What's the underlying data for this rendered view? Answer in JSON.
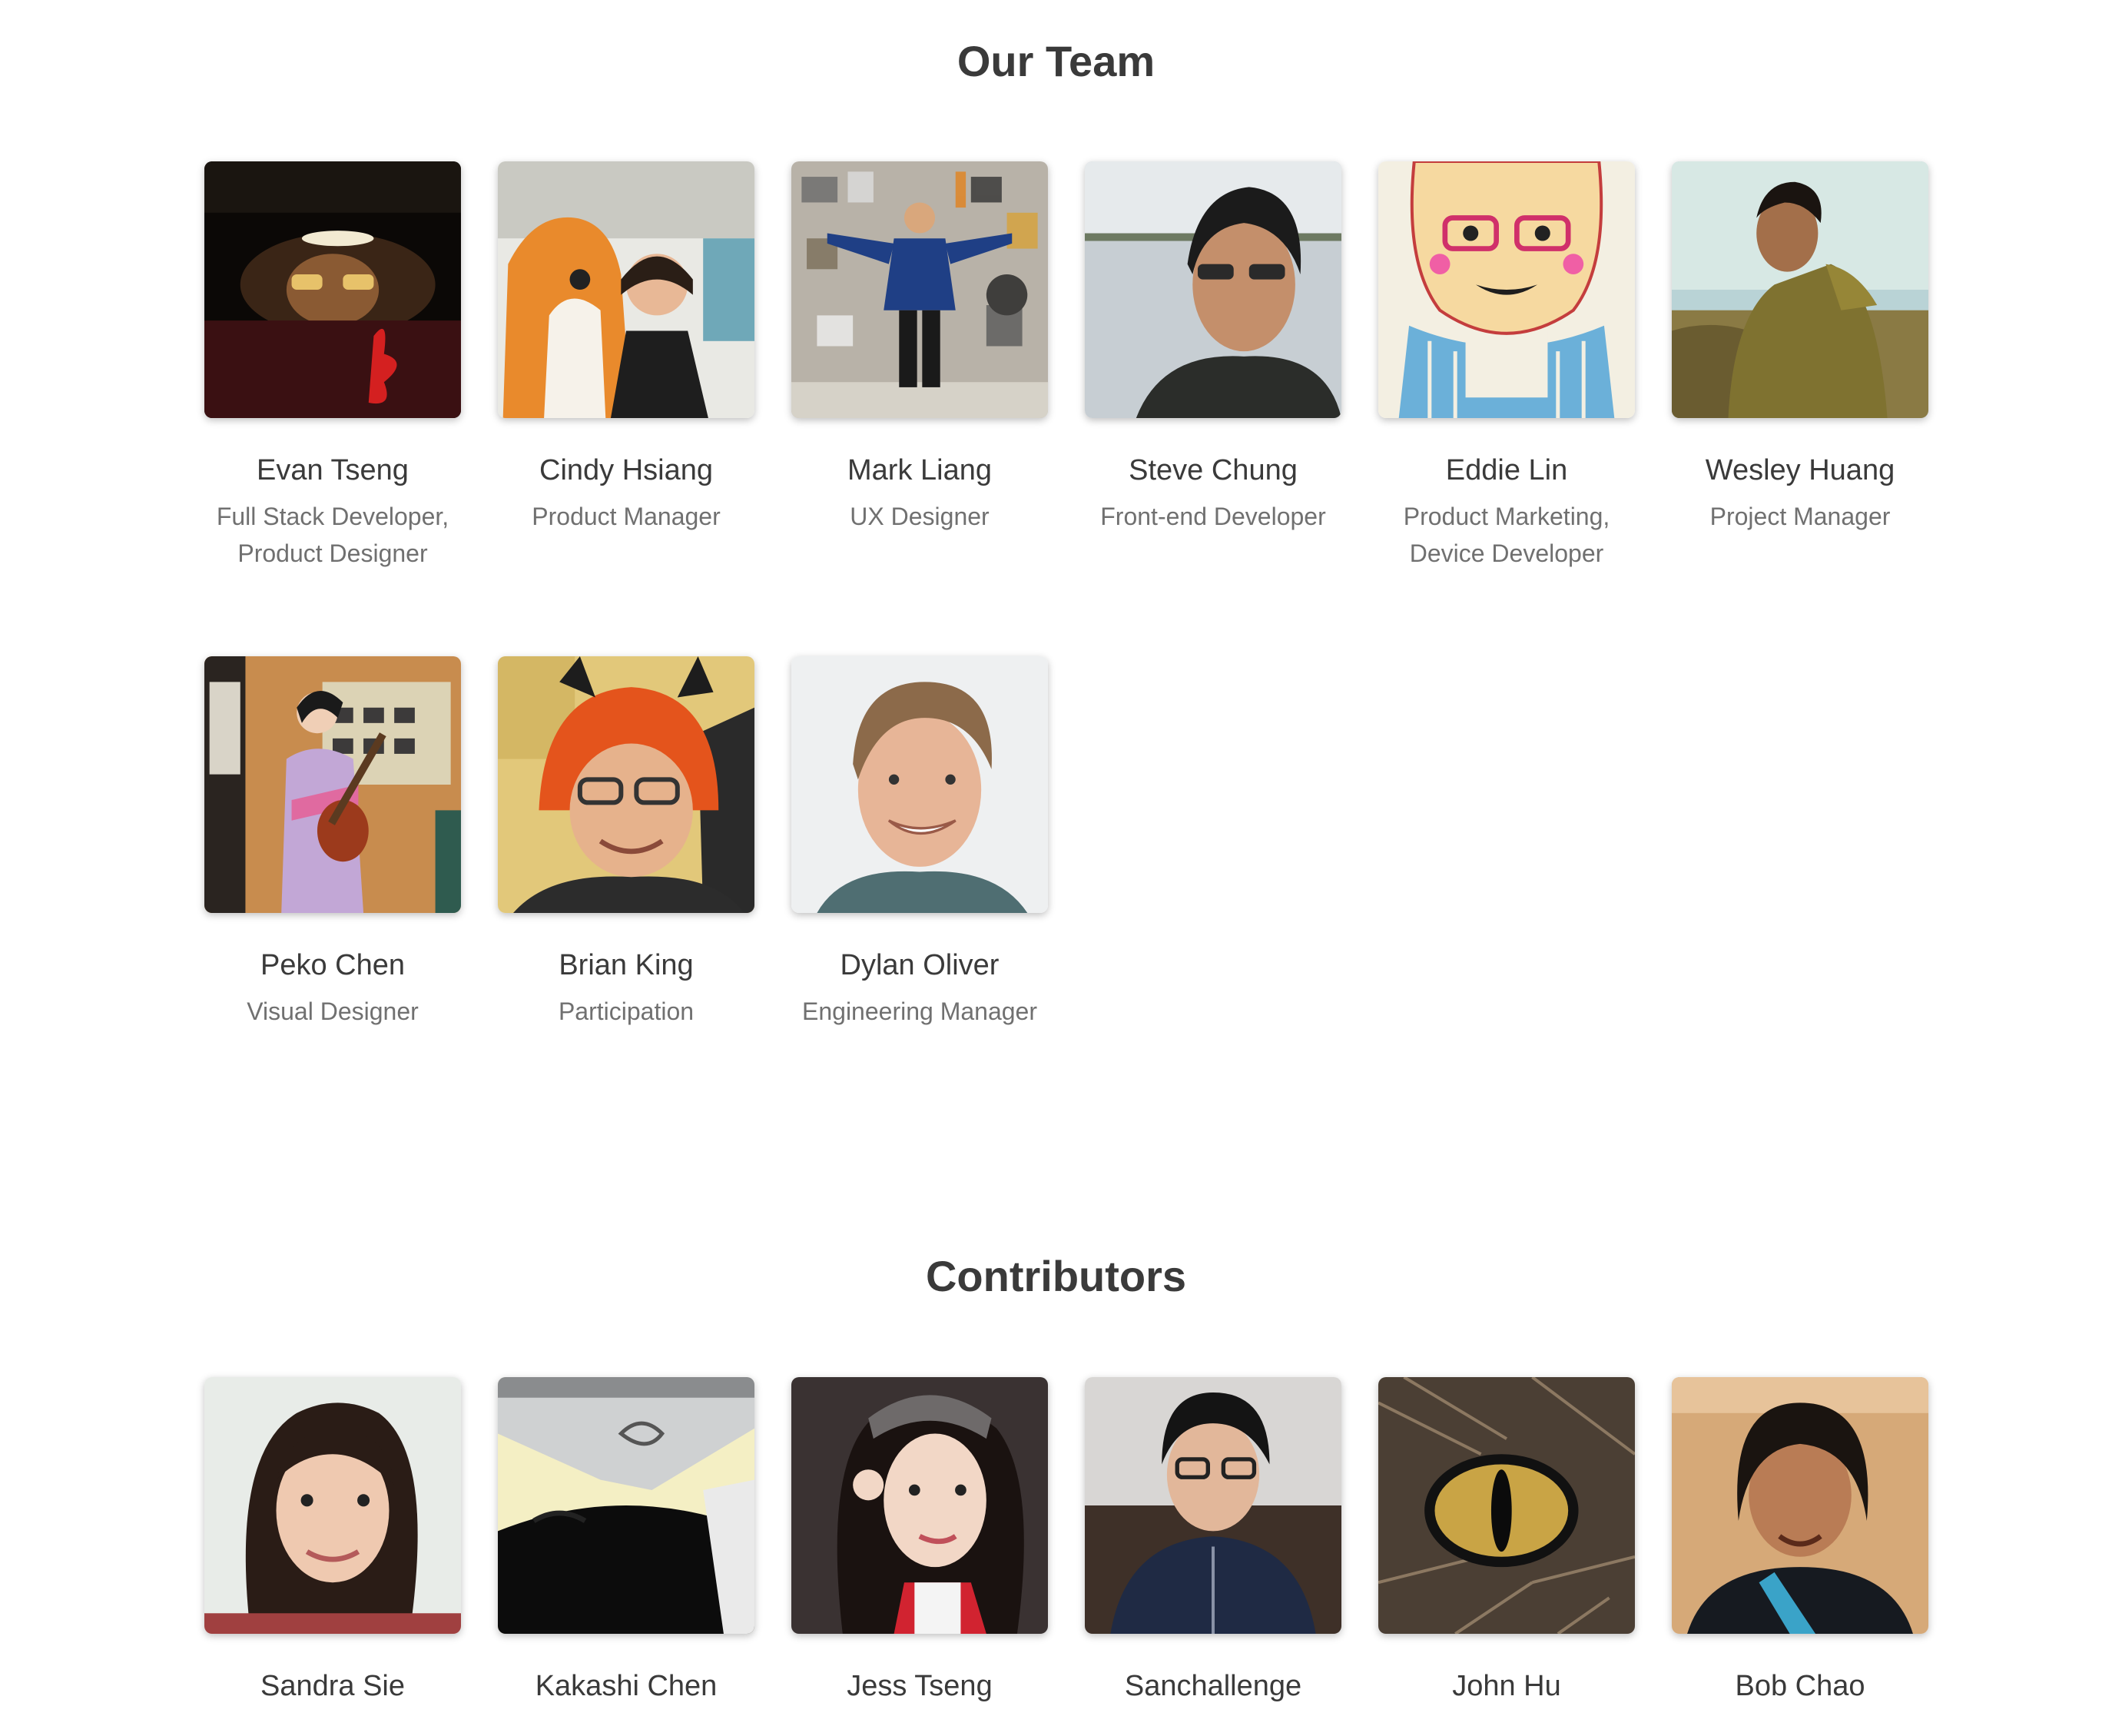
{
  "team": {
    "title": "Our Team",
    "members": [
      {
        "name": "Evan Tseng",
        "role_lines": [
          "Full Stack Developer,",
          "Product Designer"
        ]
      },
      {
        "name": "Cindy Hsiang",
        "role_lines": [
          "Product Manager"
        ]
      },
      {
        "name": "Mark Liang",
        "role_lines": [
          "UX Designer"
        ]
      },
      {
        "name": "Steve Chung",
        "role_lines": [
          "Front-end Developer"
        ]
      },
      {
        "name": "Eddie Lin",
        "role_lines": [
          "Product Marketing,",
          "Device Developer"
        ]
      },
      {
        "name": "Wesley Huang",
        "role_lines": [
          "Project Manager"
        ]
      },
      {
        "name": "Peko Chen",
        "role_lines": [
          "Visual Designer"
        ]
      },
      {
        "name": "Brian King",
        "role_lines": [
          "Participation"
        ]
      },
      {
        "name": "Dylan Oliver",
        "role_lines": [
          "Engineering Manager"
        ]
      }
    ]
  },
  "contributors": {
    "title": "Contributors",
    "members": [
      {
        "name": "Sandra Sie"
      },
      {
        "name": "Kakashi Chen"
      },
      {
        "name": "Jess Tseng"
      },
      {
        "name": "Sanchallenge"
      },
      {
        "name": "John Hu"
      },
      {
        "name": "Bob Chao"
      }
    ]
  }
}
